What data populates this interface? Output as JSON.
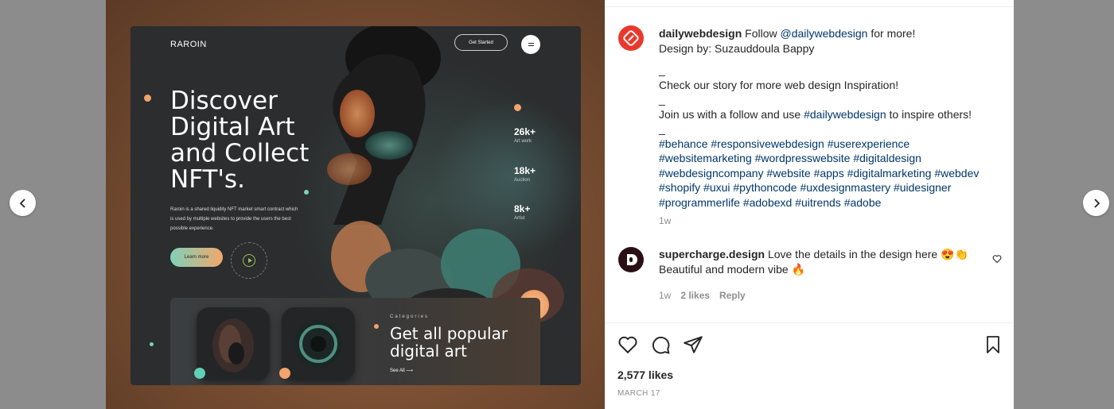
{
  "design": {
    "brand": "RAROIN",
    "get_started": "Get Started",
    "hero_title": "Discover Digital Art and Collect NFT's.",
    "hero_desc": "Raroin is a shared liquidity NFT market smart contract which is used by multiple websites to provide the users the best possible experience.",
    "learn_more": "Learn more",
    "stats": [
      {
        "num": "26k+",
        "label": "Art work"
      },
      {
        "num": "18k+",
        "label": "Auction"
      },
      {
        "num": "8k+",
        "label": "Artist"
      }
    ],
    "categories_label": "Categories",
    "categories_title": "Get all popular digital art",
    "see_all": "See All"
  },
  "post": {
    "username": "dailywebdesign",
    "caption_intro": "Follow",
    "caption_mention": "@dailywebdesign",
    "caption_more": "for more!",
    "design_by": "Design by: Suzauddoula Bappy",
    "sep1": "_",
    "story_line": "Check our story for more web design Inspiration!",
    "sep2": "_",
    "join_line": "Join us with a follow and use",
    "join_tag": "#dailywebdesign",
    "join_end": "to inspire others!",
    "sep3": "_",
    "hashtags": "#behance #responsivewebdesign #userexperience #websitemarketing #wordpresswebsite #digitaldesign #webdesigncompany #website #apps #digitalmarketing #webdev #shopify #uxui #pythoncode #uxdesignmastery #uidesigner #programmerlife #adobexd #uitrends #adobe",
    "time": "1w"
  },
  "comment": {
    "username": "supercharge.design",
    "text": "Love the details in the design here 😍👏 Beautiful and modern vibe 🔥",
    "time": "1w",
    "likes": "2 likes",
    "reply": "Reply"
  },
  "footer": {
    "likes": "2,577 likes",
    "date": "MARCH 17"
  }
}
